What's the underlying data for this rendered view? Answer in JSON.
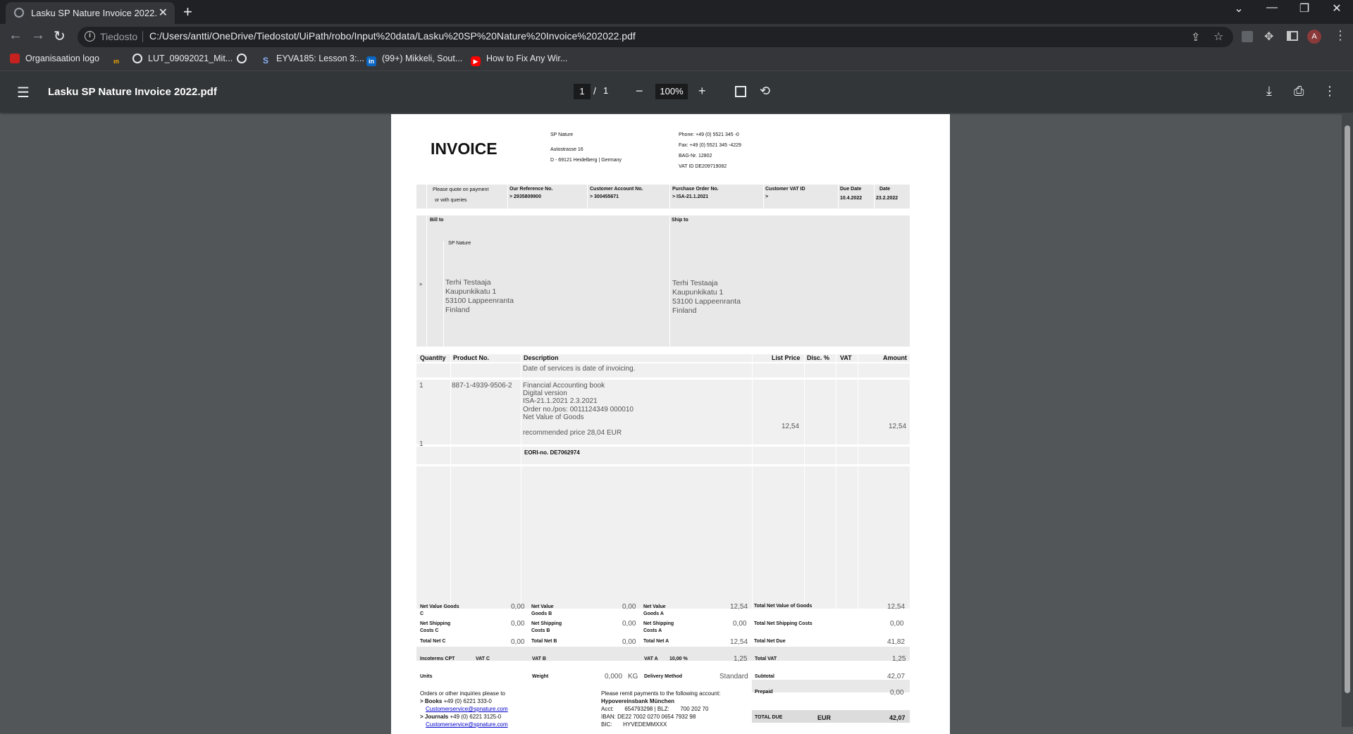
{
  "browser": {
    "tab_title": "Lasku SP Nature Invoice 2022.pdf",
    "url_label": "Tiedosto",
    "url": "C:/Users/antti/OneDrive/Tiedostot/UiPath/robo/Input%20data/Lasku%20SP%20Nature%20Invoice%202022.pdf",
    "avatar": "A",
    "bookmarks": [
      "Organisaation logo",
      "LUT_09092021_Mit...",
      "EYVA185: Lesson 3:...",
      "(99+) Mikkeli, Sout...",
      "How to Fix Any Wir..."
    ]
  },
  "viewer": {
    "file_title": "Lasku SP Nature Invoice 2022.pdf",
    "page": "1",
    "page_total": "1",
    "page_sep": "/",
    "zoom": "100%"
  },
  "invoice": {
    "heading": "INVOICE",
    "company": {
      "name": "SP Nature",
      "street": "Autostrasse 16",
      "city": "D - 69121 Heidelberg | Germany"
    },
    "contact": [
      "Phone: +49 (0) 5521 345 -0",
      "Fax: +49 (0) 5521 345 -4229",
      "BAG-Nr. 12802",
      "VAT ID DE209719082"
    ],
    "quote_note": [
      "Please quote on payment",
      "or with queries"
    ],
    "ref": {
      "our_ref_label": "Our Reference No.",
      "our_ref": "> 2935809900",
      "cust_acc_label": "Customer Account No.",
      "cust_acc": "> 300455671",
      "po_label": "Purchase Order No.",
      "po": "> ISA-21.1.2021",
      "vat_label": "Customer VAT ID",
      "vat": ">",
      "due_label": "Due Date",
      "due": "10.4.2022",
      "date_label": "Date",
      "date": "23.2.2022"
    },
    "bill_to_label": "Bill to",
    "ship_to_label": "Ship to",
    "bill_company": "SP Nature",
    "bill_marker": ">",
    "bill_addr": [
      "Terhi Testaaja",
      "Kaupunkikatu 1",
      "53100 Lappeenranta",
      "Finland"
    ],
    "ship_addr": [
      "Terhi Testaaja",
      "Kaupunkikatu 1",
      "53100 Lappeenranta",
      "Finland"
    ],
    "cols": [
      "Quantity",
      "Product No.",
      "Description",
      "List Price",
      "Disc. %",
      "VAT",
      "Amount"
    ],
    "service_note": "Date of services is date of invoicing.",
    "item": {
      "qty": "1",
      "product": "887-1-4939-9506-2",
      "desc": [
        "Financial Accounting book",
        "Digital version",
        "ISA-21.1.2021 2.3.2021",
        "Order no./pos: 0011124349 000010",
        "Net Value of Goods",
        "",
        "recommended price 28,04 EUR"
      ],
      "list_price": "12,54",
      "amount": "12,54"
    },
    "qty2": "1",
    "eori": "EORI-no. DE7062974",
    "totals": {
      "nv_c_label": "Net Value Goods C",
      "nv_c": "0,00",
      "nv_b_label": "Net Value Goods B",
      "nv_b": "0,00",
      "nv_a_label": "Net Value Goods A",
      "nv_a": "12,54",
      "tnv_label": "Total Net Value of Goods",
      "tnv": "12,54",
      "ns_c_label": "Net Shipping Costs C",
      "ns_c": "0,00",
      "ns_b_label": "Net Shipping Costs B",
      "ns_b": "0,00",
      "ns_a_label": "Net Shipping Costs A",
      "ns_a": "0,00",
      "tns_label": "Total Net Shipping Costs",
      "tns": "0,00",
      "tn_c_label": "Total Net C",
      "tn_c": "0,00",
      "tn_b_label": "Total Net B",
      "tn_b": "0,00",
      "tn_a_label": "Total Net A",
      "tn_a": "12,54",
      "tnd_label": "Total Net Due",
      "tnd": "41,82",
      "inco_label": "Incoterms CPT",
      "vatc_label": "VAT C",
      "vatb_label": "VAT B",
      "vata_label": "VAT A",
      "vata_rate": "10,00 %",
      "vata": "1,25",
      "tvat_label": "Total VAT",
      "tvat": "1,25",
      "units_label": "Units",
      "weight_label": "Weight",
      "weight": "0,000",
      "weight_unit": "KG",
      "delivery_label": "Delivery Method",
      "delivery": "Standard",
      "subtotal_label": "Subtotal",
      "subtotal": "42,07",
      "prepaid_label": "Prepaid",
      "prepaid": "0,00",
      "total_due_label": "TOTAL DUE",
      "currency": "EUR",
      "total_due": "42,07"
    },
    "footer_left": {
      "intro": "Orders or other inquiries please to",
      "books_label": "> Books",
      "books_phone": "+49 (0) 6221 333-0",
      "email": "Customerservice@spnature.com",
      "journals_label": "> Journals",
      "journals_phone": "+49 (0) 6221 3125-0",
      "email2": "Customerservice@spnature.com"
    },
    "footer_right": {
      "intro": "Please remit payments to the following account:",
      "bank": "Hypovereinsbank München",
      "acct": "Acct:       654793298 | BLZ:       700 202 70",
      "iban": "IBAN: DE22 7002 0270 0654 7932 98",
      "bic": "BIC:       HYVEDEMMXXX"
    }
  }
}
